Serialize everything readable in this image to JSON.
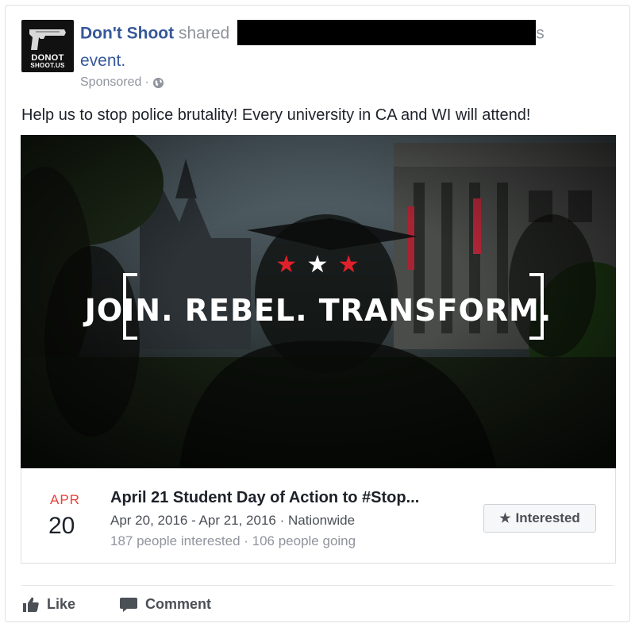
{
  "post": {
    "page_name": "Don't Shoot",
    "shared_text": "shared",
    "trailing_s": "s",
    "event_word": "event.",
    "sponsored_label": "Sponsored",
    "separator": "·",
    "caption": "Help us to stop police brutality! Every university in CA and WI will attend!"
  },
  "avatar": {
    "logo_line1": "DONOT",
    "logo_line2": "SHOOT.US"
  },
  "hero": {
    "tagline": "JOIN. REBEL. TRANSFORM.",
    "stars": [
      "★",
      "★",
      "★"
    ],
    "star_colors": [
      "#e0202a",
      "#ffffff",
      "#e0202a"
    ]
  },
  "event": {
    "month": "APR",
    "day": "20",
    "title": "April 21 Student Day of Action to #Stop...",
    "dates": "Apr 20, 2016 - Apr 21, 2016 · Nationwide",
    "stats": "187 people interested · 106 people going",
    "interested_label": "Interested",
    "interested_icon": "star-icon"
  },
  "actions": {
    "like_label": "Like",
    "comment_label": "Comment",
    "like_icon": "thumbs-up-icon",
    "comment_icon": "speech-bubble-icon"
  },
  "colors": {
    "page_link": "#365899",
    "muted": "#90949c",
    "month_red": "#e9403d"
  }
}
